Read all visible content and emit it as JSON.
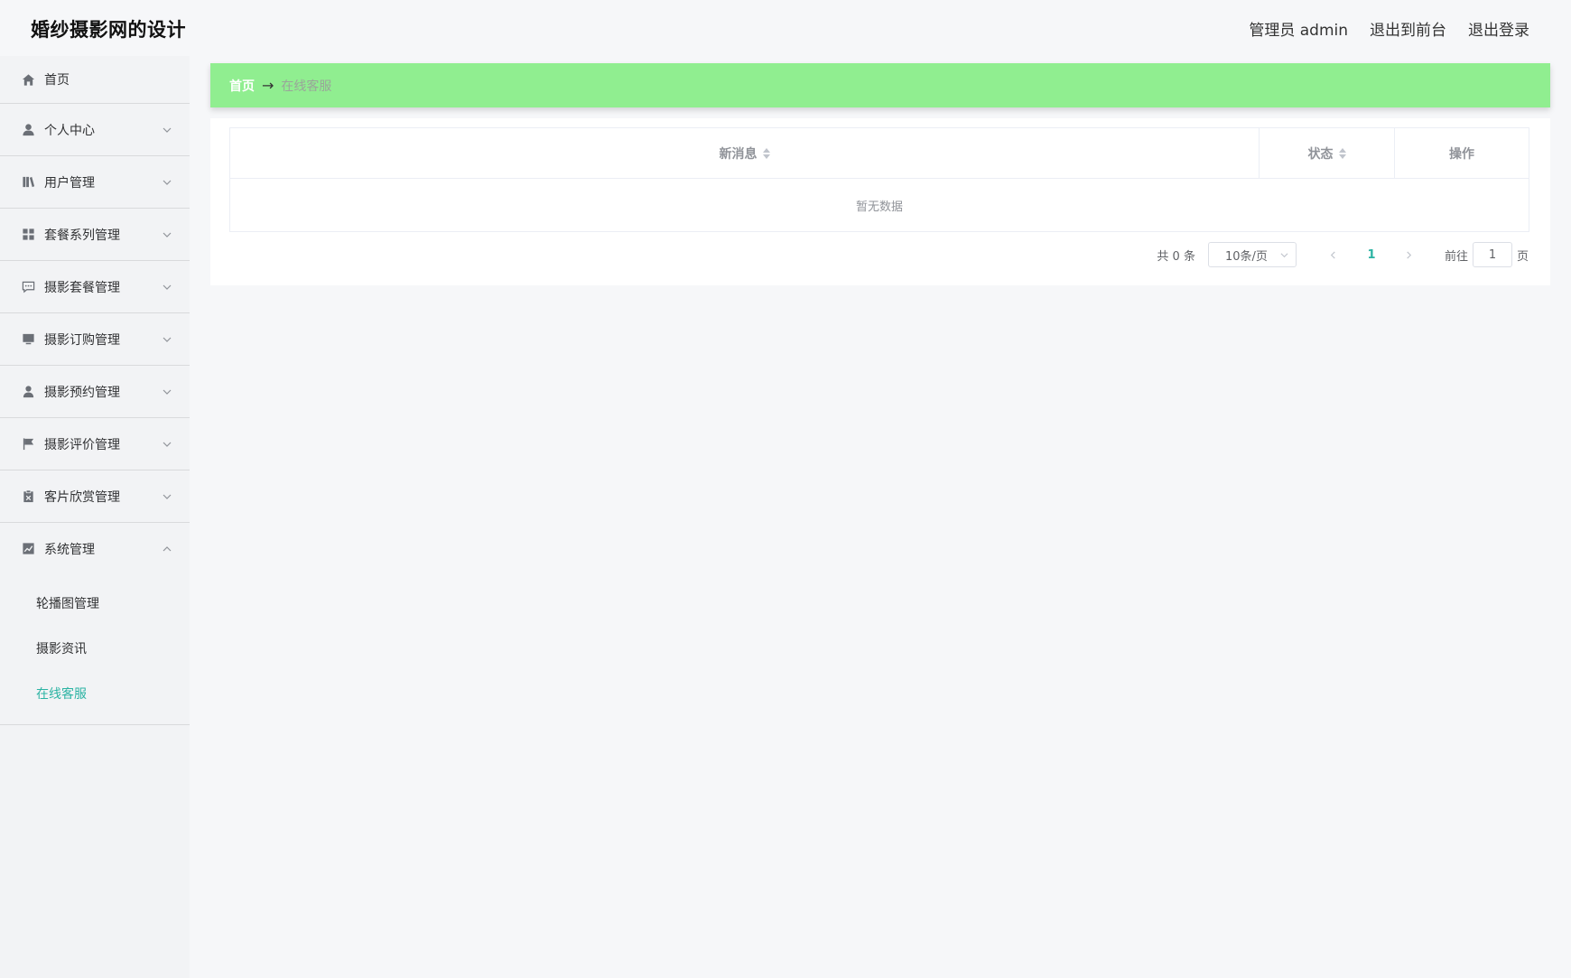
{
  "header": {
    "title": "婚纱摄影网的设计",
    "admin_label": "管理员 admin",
    "front_link": "退出到前台",
    "logout_link": "退出登录"
  },
  "sidebar": {
    "items": [
      {
        "label": "首页",
        "icon": "home-icon"
      },
      {
        "label": "个人中心",
        "icon": "user-icon"
      },
      {
        "label": "用户管理",
        "icon": "book-icon"
      },
      {
        "label": "套餐系列管理",
        "icon": "grid-icon"
      },
      {
        "label": "摄影套餐管理",
        "icon": "chat-icon"
      },
      {
        "label": "摄影订购管理",
        "icon": "monitor-icon"
      },
      {
        "label": "摄影预约管理",
        "icon": "person-icon"
      },
      {
        "label": "摄影评价管理",
        "icon": "flag-icon"
      },
      {
        "label": "客片欣赏管理",
        "icon": "clipboard-icon"
      },
      {
        "label": "系统管理",
        "icon": "chart-icon"
      }
    ],
    "submenu": [
      {
        "label": "轮播图管理"
      },
      {
        "label": "摄影资讯"
      },
      {
        "label": "在线客服"
      }
    ]
  },
  "breadcrumb": {
    "home": "首页",
    "separator": "→",
    "current": "在线客服"
  },
  "table": {
    "columns": [
      "新消息",
      "状态",
      "操作"
    ],
    "empty_text": "暂无数据"
  },
  "pagination": {
    "total": "共 0 条",
    "page_size": "10条/页",
    "current_page": "1",
    "goto_label": "前往",
    "goto_value": "1",
    "page_suffix": "页"
  },
  "colors": {
    "breadcrumb_bg": "#90ee90",
    "accent": "#2bb3a3"
  }
}
